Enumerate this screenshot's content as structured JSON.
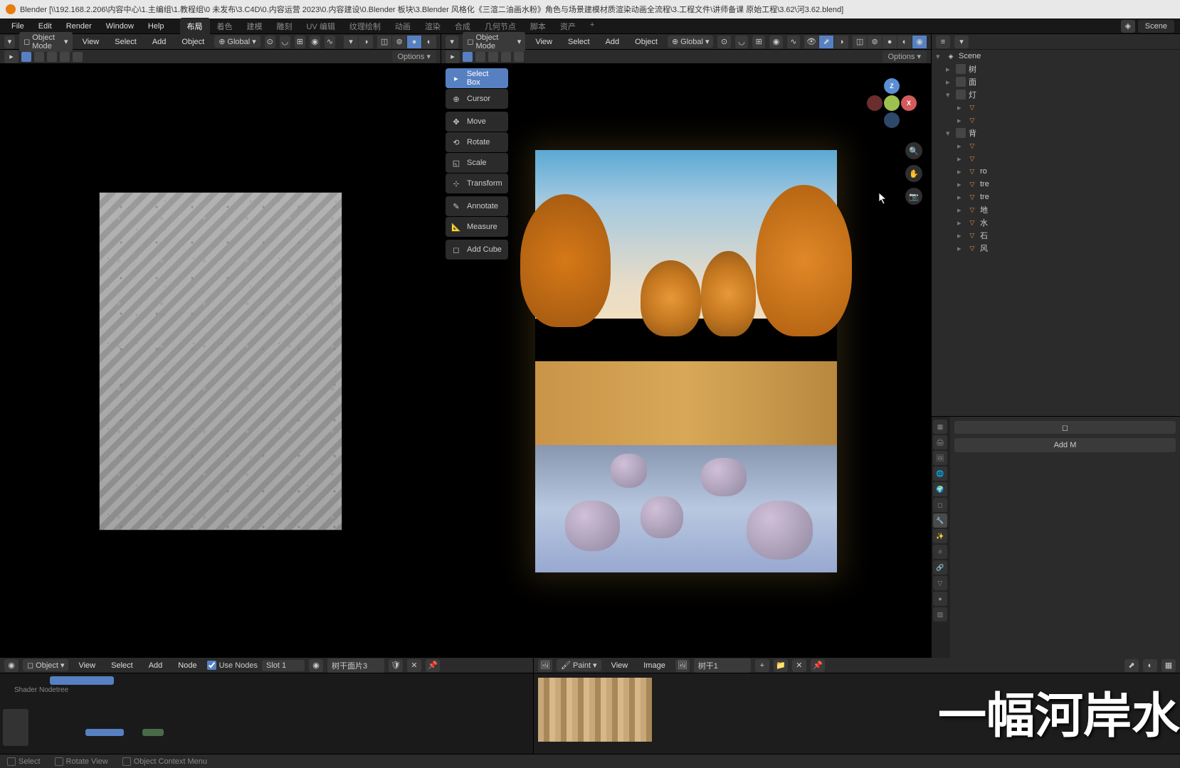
{
  "title": "Blender [\\\\192.168.2.206\\内容中心\\1.主编组\\1.教程组\\0 未发布\\3.C4D\\0.内容运营 2023\\0.内容建设\\0.Blender 板块\\3.Blender 风格化《三渲二油画水粉》角色与场景建模材质渲染动画全流程\\3.工程文件\\讲师备课 原始工程\\3.62\\河3.62.blend]",
  "menu": [
    "File",
    "Edit",
    "Render",
    "Window",
    "Help"
  ],
  "tabs": [
    "布局",
    "着色",
    "建模",
    "雕刻",
    "UV 编辑",
    "纹理绘制",
    "动画",
    "渲染",
    "合成",
    "几何节点",
    "脚本",
    "资产"
  ],
  "active_tab": 0,
  "scene_name": "Scene",
  "viewport": {
    "mode": "Object Mode",
    "vmenu": [
      "View",
      "Select",
      "Add",
      "Object"
    ],
    "orient": "Global",
    "options": "Options"
  },
  "tools": {
    "select_box": "Select Box",
    "cursor": "Cursor",
    "move": "Move",
    "rotate": "Rotate",
    "scale": "Scale",
    "transform": "Transform",
    "annotate": "Annotate",
    "measure": "Measure",
    "add_cube": "Add Cube"
  },
  "node_editor": {
    "type": "Object",
    "menu": [
      "View",
      "Select",
      "Add",
      "Node"
    ],
    "use_nodes": "Use Nodes",
    "slot": "Slot 1",
    "material": "树干面片3",
    "tree_label": "Shader Nodetree"
  },
  "image_editor": {
    "mode": "Paint",
    "menu": [
      "View",
      "Image"
    ],
    "image_name": "树干1"
  },
  "outliner": {
    "scene_label": "Scene",
    "items": [
      {
        "label": "树",
        "type": "coll",
        "lv": 0
      },
      {
        "label": "面",
        "type": "coll",
        "lv": 0
      },
      {
        "label": "灯",
        "type": "coll",
        "lv": 0,
        "open": true
      },
      {
        "label": "",
        "type": "obj",
        "lv": 1
      },
      {
        "label": "",
        "type": "obj",
        "lv": 1
      },
      {
        "label": "背",
        "type": "coll",
        "lv": 0,
        "open": true
      },
      {
        "label": "",
        "type": "obj",
        "lv": 1
      },
      {
        "label": "",
        "type": "obj",
        "lv": 1
      },
      {
        "label": "ro",
        "type": "obj",
        "lv": 1
      },
      {
        "label": "tre",
        "type": "obj",
        "lv": 1
      },
      {
        "label": "tre",
        "type": "obj",
        "lv": 1
      },
      {
        "label": "地",
        "type": "obj",
        "lv": 1
      },
      {
        "label": "水",
        "type": "obj",
        "lv": 1
      },
      {
        "label": "石",
        "type": "obj",
        "lv": 1
      },
      {
        "label": "风",
        "type": "obj",
        "lv": 1
      }
    ]
  },
  "properties": {
    "add_modifier": "Add M"
  },
  "status": {
    "select": "Select",
    "rotate": "Rotate View",
    "context": "Object Context Menu"
  },
  "overlay": "一幅河岸水"
}
